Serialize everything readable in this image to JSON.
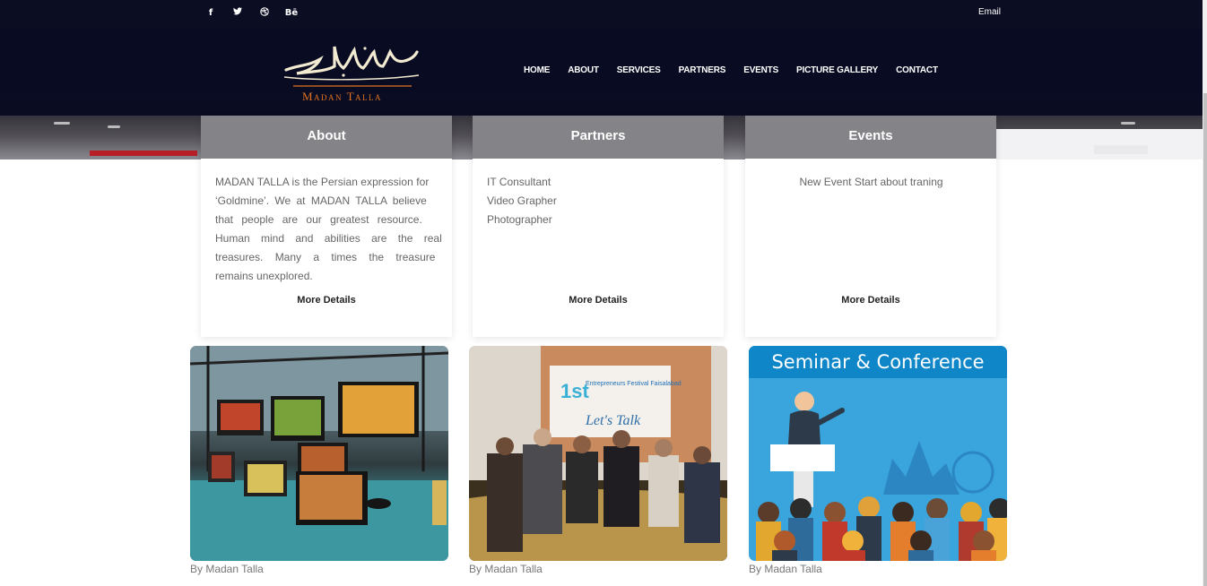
{
  "topbar": {
    "social": [
      {
        "icon": "facebook-icon",
        "glyph": "f"
      },
      {
        "icon": "twitter-icon",
        "glyph": "🐦"
      },
      {
        "icon": "dribbble-icon",
        "glyph": "⊛"
      },
      {
        "icon": "behance-icon",
        "glyph": "Bē"
      }
    ],
    "email_label": "Email"
  },
  "brand": {
    "name": "Madan Talla",
    "accent_color": "#e0731f"
  },
  "nav": {
    "items": [
      "HOME",
      "ABOUT",
      "SERVICES",
      "PARTNERS",
      "EVENTS",
      "PICTURE GALLERY",
      "CONTACT"
    ]
  },
  "cards": [
    {
      "title": "About",
      "lines": [
        "MADAN TALLA is the Persian expression for",
        "‘Goldmine’. We at MADAN TALLA believe",
        "that people are our greatest resource.",
        "Human mind and abilities are the real",
        "treasures. Many a times the treasure",
        "remains unexplored."
      ],
      "more": "More Details"
    },
    {
      "title": "Partners",
      "lines": [
        "IT Consultant",
        "Video Grapher",
        "Photographer"
      ],
      "more": "More Details"
    },
    {
      "title": "Events",
      "lines": [
        "New Event Start about traning"
      ],
      "more": "More Details"
    }
  ],
  "gallery": [
    {
      "caption": "By Madan Talla"
    },
    {
      "caption": "By Madan Talla",
      "banner_title": "Entrepreneurs Festival Faisalabad",
      "banner_number": "1st",
      "banner_tag": "Let's Talk"
    },
    {
      "caption": "By Madan Talla",
      "banner": "Seminar & Conference"
    }
  ]
}
